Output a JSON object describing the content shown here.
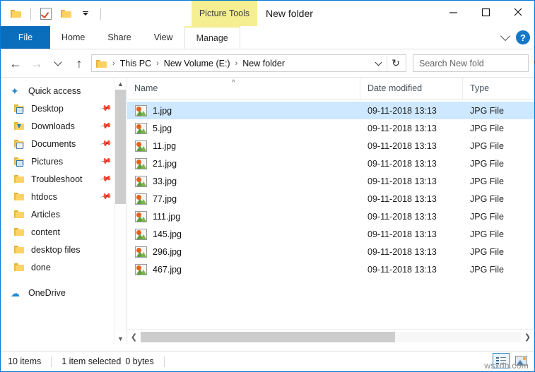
{
  "window": {
    "title": "New folder",
    "contextual_tab_group": "Picture Tools",
    "controls": {
      "minimize": "—",
      "maximize": "☐",
      "close": "✕"
    }
  },
  "quick_access_toolbar": {
    "items": [
      {
        "name": "folder-icon",
        "label": ""
      },
      {
        "name": "properties-icon",
        "label": ""
      },
      {
        "name": "new-folder-icon",
        "label": ""
      },
      {
        "name": "customize-dropdown",
        "label": ""
      }
    ]
  },
  "ribbon": {
    "tabs": [
      {
        "label": "File",
        "active": true
      },
      {
        "label": "Home",
        "active": false
      },
      {
        "label": "Share",
        "active": false
      },
      {
        "label": "View",
        "active": false
      },
      {
        "label": "Manage",
        "active": false
      }
    ],
    "expand_label": "",
    "help_label": "?"
  },
  "address_bar": {
    "back": "←",
    "forward": "→",
    "recent": "",
    "up": "↑",
    "breadcrumbs": [
      "This PC",
      "New Volume (E:)",
      "New folder"
    ],
    "separator": "›",
    "refresh": "↻"
  },
  "search": {
    "placeholder": "Search New fold",
    "value": ""
  },
  "sidebar": {
    "items": [
      {
        "label": "Quick access",
        "icon": "star-icon",
        "pinned": false,
        "root": true
      },
      {
        "label": "Desktop",
        "icon": "folder-desktop-icon",
        "pinned": true,
        "root": false
      },
      {
        "label": "Downloads",
        "icon": "folder-downloads-icon",
        "pinned": true,
        "root": false
      },
      {
        "label": "Documents",
        "icon": "folder-documents-icon",
        "pinned": true,
        "root": false
      },
      {
        "label": "Pictures",
        "icon": "folder-pictures-icon",
        "pinned": true,
        "root": false
      },
      {
        "label": "Troubleshoot",
        "icon": "folder-icon",
        "pinned": true,
        "root": false
      },
      {
        "label": "htdocs",
        "icon": "folder-icon",
        "pinned": true,
        "root": false
      },
      {
        "label": "Articles",
        "icon": "folder-icon",
        "pinned": false,
        "root": false
      },
      {
        "label": "content",
        "icon": "folder-icon",
        "pinned": false,
        "root": false
      },
      {
        "label": "desktop files",
        "icon": "folder-icon",
        "pinned": false,
        "root": false
      },
      {
        "label": "done",
        "icon": "folder-icon",
        "pinned": false,
        "root": false
      },
      {
        "label": "OneDrive",
        "icon": "cloud-icon",
        "pinned": false,
        "root": true
      }
    ]
  },
  "file_list": {
    "columns": [
      "Name",
      "Date modified",
      "Type"
    ],
    "sort_column": "Name",
    "sort_direction": "ascending",
    "rows": [
      {
        "name": "1.jpg",
        "date": "09-11-2018 13:13",
        "type": "JPG File",
        "selected": true
      },
      {
        "name": "5.jpg",
        "date": "09-11-2018 13:13",
        "type": "JPG File",
        "selected": false
      },
      {
        "name": "11.jpg",
        "date": "09-11-2018 13:13",
        "type": "JPG File",
        "selected": false
      },
      {
        "name": "21.jpg",
        "date": "09-11-2018 13:13",
        "type": "JPG File",
        "selected": false
      },
      {
        "name": "33.jpg",
        "date": "09-11-2018 13:13",
        "type": "JPG File",
        "selected": false
      },
      {
        "name": "77.jpg",
        "date": "09-11-2018 13:13",
        "type": "JPG File",
        "selected": false
      },
      {
        "name": "111.jpg",
        "date": "09-11-2018 13:13",
        "type": "JPG File",
        "selected": false
      },
      {
        "name": "145.jpg",
        "date": "09-11-2018 13:13",
        "type": "JPG File",
        "selected": false
      },
      {
        "name": "296.jpg",
        "date": "09-11-2018 13:13",
        "type": "JPG File",
        "selected": false
      },
      {
        "name": "467.jpg",
        "date": "09-11-2018 13:13",
        "type": "JPG File",
        "selected": false
      }
    ]
  },
  "status_bar": {
    "item_count": "10 items",
    "selection": "1 item selected",
    "size": "0 bytes",
    "views": [
      {
        "name": "details-view",
        "active": true
      },
      {
        "name": "large-icons-view",
        "active": false
      }
    ]
  },
  "watermark": "wsxdn.com",
  "colors": {
    "accent": "#0078d7",
    "file_tab": "#0b6ebd",
    "contextual_tab": "#f5ef91",
    "selection": "#cde8ff",
    "folder": "#fdd365"
  }
}
